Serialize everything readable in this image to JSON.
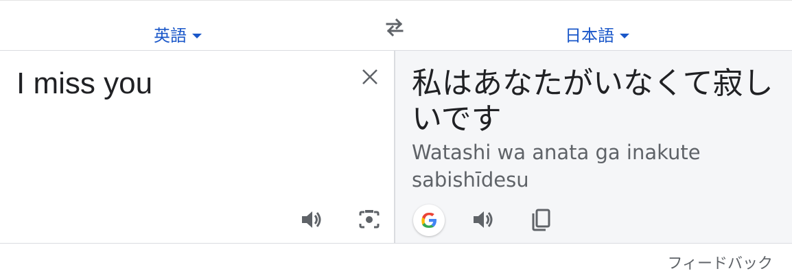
{
  "languages": {
    "source": "英語",
    "target": "日本語"
  },
  "source_panel": {
    "text": "I miss you"
  },
  "target_panel": {
    "translation": "私はあなたがいなくて寂しいです",
    "romanization": "Watashi wa anata ga inakute sabishīdesu"
  },
  "footer": {
    "feedback_label": "フィードバック"
  },
  "icons": {
    "swap": "swap-arrows-icon",
    "caret": "caret-down-icon",
    "clear": "close-icon",
    "speak": "speaker-icon",
    "camera": "camera-icon",
    "google": "google-logo-icon",
    "copy": "copy-icon"
  },
  "colors": {
    "accent": "#1a57c9",
    "icon": "#5f6368",
    "panel_bg": "#f5f6f8"
  }
}
